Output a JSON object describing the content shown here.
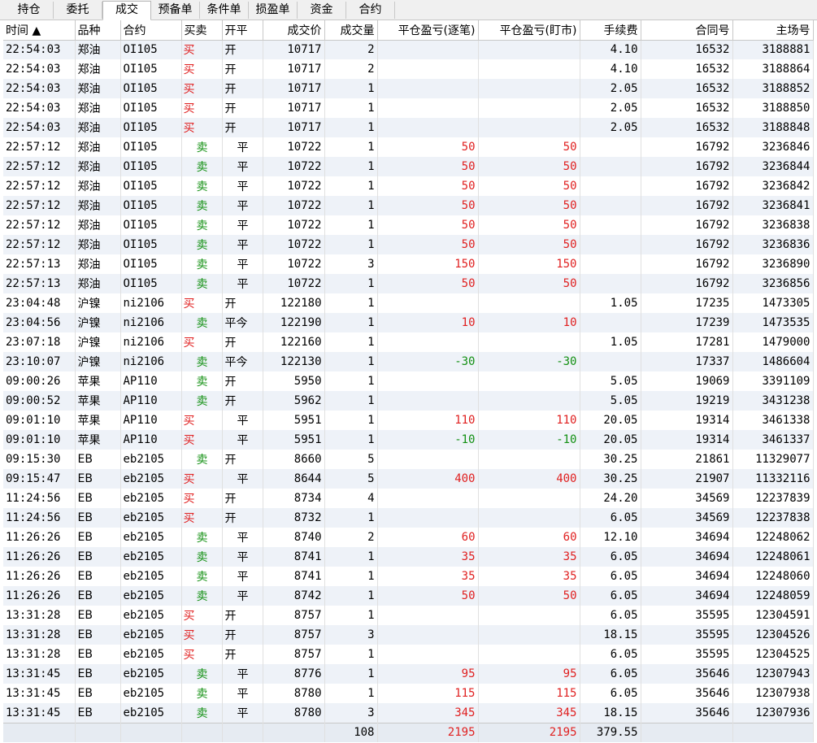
{
  "tabs": [
    {
      "label": "持仓",
      "active": false
    },
    {
      "label": "委托",
      "active": false
    },
    {
      "label": "成交",
      "active": true
    },
    {
      "label": "预备单",
      "active": false
    },
    {
      "label": "条件单",
      "active": false
    },
    {
      "label": "损盈单",
      "active": false
    },
    {
      "label": "资金",
      "active": false
    },
    {
      "label": "合约",
      "active": false
    }
  ],
  "columns": {
    "time": "时间 ▲",
    "variety": "品种",
    "contract": "合约",
    "side": "买卖",
    "offset": "开平",
    "price": "成交价",
    "qty": "成交量",
    "pnl_trade": "平仓盈亏(逐笔)",
    "pnl_mtm": "平仓盈亏(盯市)",
    "fee": "手续费",
    "contract_no": "合同号",
    "main_no": "主场号"
  },
  "side_colors": {
    "buy": "#e02020",
    "sell": "#139013"
  },
  "rows": [
    [
      "22:54:03",
      "郑油",
      "OI105",
      "买",
      "开",
      "10717",
      "2",
      "",
      "",
      "4.10",
      "16532",
      "3188881"
    ],
    [
      "22:54:03",
      "郑油",
      "OI105",
      "买",
      "开",
      "10717",
      "2",
      "",
      "",
      "4.10",
      "16532",
      "3188864"
    ],
    [
      "22:54:03",
      "郑油",
      "OI105",
      "买",
      "开",
      "10717",
      "1",
      "",
      "",
      "2.05",
      "16532",
      "3188852"
    ],
    [
      "22:54:03",
      "郑油",
      "OI105",
      "买",
      "开",
      "10717",
      "1",
      "",
      "",
      "2.05",
      "16532",
      "3188850"
    ],
    [
      "22:54:03",
      "郑油",
      "OI105",
      "买",
      "开",
      "10717",
      "1",
      "",
      "",
      "2.05",
      "16532",
      "3188848"
    ],
    [
      "22:57:12",
      "郑油",
      "OI105",
      "卖",
      "平",
      "10722",
      "1",
      "50",
      "50",
      "",
      "16792",
      "3236846"
    ],
    [
      "22:57:12",
      "郑油",
      "OI105",
      "卖",
      "平",
      "10722",
      "1",
      "50",
      "50",
      "",
      "16792",
      "3236844"
    ],
    [
      "22:57:12",
      "郑油",
      "OI105",
      "卖",
      "平",
      "10722",
      "1",
      "50",
      "50",
      "",
      "16792",
      "3236842"
    ],
    [
      "22:57:12",
      "郑油",
      "OI105",
      "卖",
      "平",
      "10722",
      "1",
      "50",
      "50",
      "",
      "16792",
      "3236841"
    ],
    [
      "22:57:12",
      "郑油",
      "OI105",
      "卖",
      "平",
      "10722",
      "1",
      "50",
      "50",
      "",
      "16792",
      "3236838"
    ],
    [
      "22:57:12",
      "郑油",
      "OI105",
      "卖",
      "平",
      "10722",
      "1",
      "50",
      "50",
      "",
      "16792",
      "3236836"
    ],
    [
      "22:57:13",
      "郑油",
      "OI105",
      "卖",
      "平",
      "10722",
      "3",
      "150",
      "150",
      "",
      "16792",
      "3236890"
    ],
    [
      "22:57:13",
      "郑油",
      "OI105",
      "卖",
      "平",
      "10722",
      "1",
      "50",
      "50",
      "",
      "16792",
      "3236856"
    ],
    [
      "23:04:48",
      "沪镍",
      "ni2106",
      "买",
      "开",
      "122180",
      "1",
      "",
      "",
      "1.05",
      "17235",
      "1473305"
    ],
    [
      "23:04:56",
      "沪镍",
      "ni2106",
      "卖",
      "平今",
      "122190",
      "1",
      "10",
      "10",
      "",
      "17239",
      "1473535"
    ],
    [
      "23:07:18",
      "沪镍",
      "ni2106",
      "买",
      "开",
      "122160",
      "1",
      "",
      "",
      "1.05",
      "17281",
      "1479000"
    ],
    [
      "23:10:07",
      "沪镍",
      "ni2106",
      "卖",
      "平今",
      "122130",
      "1",
      "-30",
      "-30",
      "",
      "17337",
      "1486604"
    ],
    [
      "09:00:26",
      "苹果",
      "AP110",
      "卖",
      "开",
      "5950",
      "1",
      "",
      "",
      "5.05",
      "19069",
      "3391109"
    ],
    [
      "09:00:52",
      "苹果",
      "AP110",
      "卖",
      "开",
      "5962",
      "1",
      "",
      "",
      "5.05",
      "19219",
      "3431238"
    ],
    [
      "09:01:10",
      "苹果",
      "AP110",
      "买",
      "平",
      "5951",
      "1",
      "110",
      "110",
      "20.05",
      "19314",
      "3461338"
    ],
    [
      "09:01:10",
      "苹果",
      "AP110",
      "买",
      "平",
      "5951",
      "1",
      "-10",
      "-10",
      "20.05",
      "19314",
      "3461337"
    ],
    [
      "09:15:30",
      "EB",
      "eb2105",
      "卖",
      "开",
      "8660",
      "5",
      "",
      "",
      "30.25",
      "21861",
      "11329077"
    ],
    [
      "09:15:47",
      "EB",
      "eb2105",
      "买",
      "平",
      "8644",
      "5",
      "400",
      "400",
      "30.25",
      "21907",
      "11332116"
    ],
    [
      "11:24:56",
      "EB",
      "eb2105",
      "买",
      "开",
      "8734",
      "4",
      "",
      "",
      "24.20",
      "34569",
      "12237839"
    ],
    [
      "11:24:56",
      "EB",
      "eb2105",
      "买",
      "开",
      "8732",
      "1",
      "",
      "",
      "6.05",
      "34569",
      "12237838"
    ],
    [
      "11:26:26",
      "EB",
      "eb2105",
      "卖",
      "平",
      "8740",
      "2",
      "60",
      "60",
      "12.10",
      "34694",
      "12248062"
    ],
    [
      "11:26:26",
      "EB",
      "eb2105",
      "卖",
      "平",
      "8741",
      "1",
      "35",
      "35",
      "6.05",
      "34694",
      "12248061"
    ],
    [
      "11:26:26",
      "EB",
      "eb2105",
      "卖",
      "平",
      "8741",
      "1",
      "35",
      "35",
      "6.05",
      "34694",
      "12248060"
    ],
    [
      "11:26:26",
      "EB",
      "eb2105",
      "卖",
      "平",
      "8742",
      "1",
      "50",
      "50",
      "6.05",
      "34694",
      "12248059"
    ],
    [
      "13:31:28",
      "EB",
      "eb2105",
      "买",
      "开",
      "8757",
      "1",
      "",
      "",
      "6.05",
      "35595",
      "12304591"
    ],
    [
      "13:31:28",
      "EB",
      "eb2105",
      "买",
      "开",
      "8757",
      "3",
      "",
      "",
      "18.15",
      "35595",
      "12304526"
    ],
    [
      "13:31:28",
      "EB",
      "eb2105",
      "买",
      "开",
      "8757",
      "1",
      "",
      "",
      "6.05",
      "35595",
      "12304525"
    ],
    [
      "13:31:45",
      "EB",
      "eb2105",
      "卖",
      "平",
      "8776",
      "1",
      "95",
      "95",
      "6.05",
      "35646",
      "12307943"
    ],
    [
      "13:31:45",
      "EB",
      "eb2105",
      "卖",
      "平",
      "8780",
      "1",
      "115",
      "115",
      "6.05",
      "35646",
      "12307938"
    ],
    [
      "13:31:45",
      "EB",
      "eb2105",
      "卖",
      "平",
      "8780",
      "3",
      "345",
      "345",
      "18.15",
      "35646",
      "12307936"
    ]
  ],
  "totals": {
    "qty": "108",
    "pnl_trade": "2195",
    "pnl_mtm": "2195",
    "fee": "379.55"
  }
}
